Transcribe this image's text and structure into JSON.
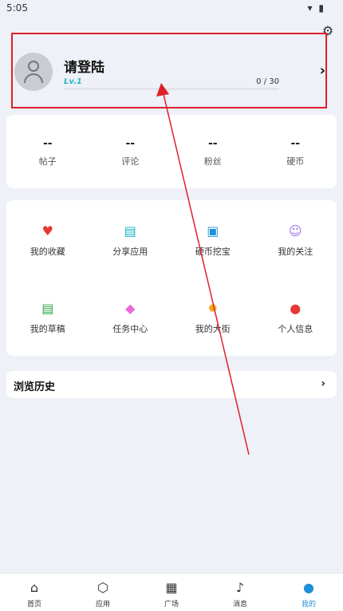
{
  "status_bar": {
    "time": "5:05",
    "indicators": "▾ ▮"
  },
  "settings_icon": "⚙",
  "profile": {
    "name": "请登陆",
    "level": "Lv.1",
    "progress_text": "0 / 30",
    "progress_fraction": 0.0
  },
  "stats": [
    {
      "value": "--",
      "label": "帖子"
    },
    {
      "value": "--",
      "label": "评论"
    },
    {
      "value": "--",
      "label": "粉丝"
    },
    {
      "value": "--",
      "label": "硬币"
    }
  ],
  "grid": [
    {
      "label": "我的收藏",
      "icon": "♥",
      "icon_name": "heart-icon",
      "color": "#e53935"
    },
    {
      "label": "分享应用",
      "icon": "▤",
      "icon_name": "document-icon",
      "color": "#1ab3c8"
    },
    {
      "label": "硬币挖宝",
      "icon": "▣",
      "icon_name": "treasure-icon",
      "color": "#1e90d8"
    },
    {
      "label": "我的关注",
      "icon": "☺",
      "icon_name": "followers-icon",
      "color": "#a06ee6"
    },
    {
      "label": "我的草稿",
      "icon": "▤",
      "icon_name": "draft-icon",
      "color": "#2e9e48"
    },
    {
      "label": "任务中心",
      "icon": "◆",
      "icon_name": "tag-icon",
      "color": "#e86ad8"
    },
    {
      "label": "我的大街",
      "icon": "✹",
      "icon_name": "street-icon",
      "color": "#f2a516"
    },
    {
      "label": "个人信息",
      "icon": "●",
      "icon_name": "person-icon",
      "color": "#e53935"
    }
  ],
  "history": {
    "label": "浏览历史"
  },
  "tabs": [
    {
      "label": "首页",
      "icon": "⌂",
      "icon_name": "home-icon",
      "active": false
    },
    {
      "label": "应用",
      "icon": "⬡",
      "icon_name": "app-icon",
      "active": false
    },
    {
      "label": "广场",
      "icon": "▦",
      "icon_name": "square-icon",
      "active": false
    },
    {
      "label": "消息",
      "icon": "♪",
      "icon_name": "bell-icon",
      "active": false
    },
    {
      "label": "我的",
      "icon": "●",
      "icon_name": "user-icon",
      "active": true
    }
  ],
  "colors": {
    "accent": "#2bb5c8",
    "annotation": "#e0202a",
    "active_tab": "#1e90d8"
  }
}
